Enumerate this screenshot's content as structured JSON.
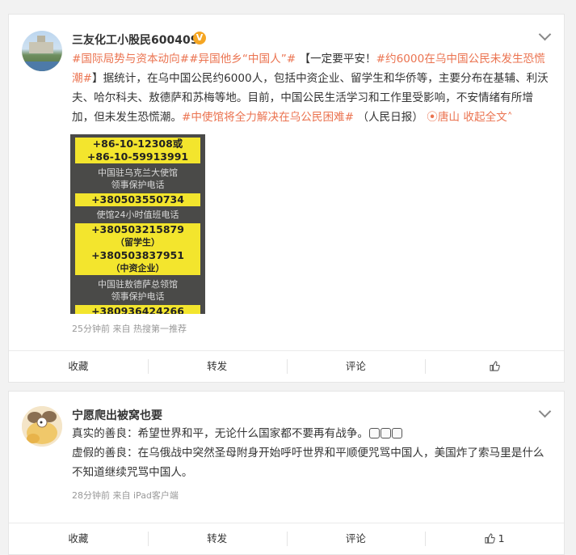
{
  "post1": {
    "username": "三友化工小股民600409",
    "verified_badge": "V",
    "hashtag1": "#国际局势与资本动向#",
    "hashtag2": "#异国他乡“中国人”#",
    "text1": "【一定要平安！",
    "hashtag3": "#约6000在乌中国公民未发生恐慌潮#",
    "text2": "】据统计，在乌中国公民约6000人，包括中资企业、留学生和华侨等，主要分布在基辅、利沃夫、哈尔科夫、敖德萨和苏梅等地。目前，中国公民生活学习和工作里受影响，不安情绪有所增加，但未发生恐慌潮。",
    "hashtag4": "#中使馆将全力解决在乌公民困难#",
    "text3": "（人民日报）",
    "location": "唐山",
    "collapse": "收起全文",
    "poster": {
      "line1": "+86-10-12308或",
      "line2": "+86-10-59913991",
      "line3": "中国驻乌克兰大使馆",
      "line4": "领事保护电话",
      "line5": "+380503550734",
      "line6": "使馆24小时值班电话",
      "line7": "+380503215879",
      "line8": "（留学生）",
      "line9": "+380503837951",
      "line10": "（中资企业）",
      "line11": "中国驻敖德萨总领馆",
      "line12": "领事保护电话",
      "line13": "+380936424266"
    },
    "time": "25分钟前",
    "source": "来自 热搜第一推荐",
    "actions": {
      "favorite": "收藏",
      "repost": "转发",
      "comment": "评论"
    }
  },
  "post2": {
    "username": "宁愿爬出被窝也要",
    "line1": "真实的善良：希望世界和平，无论什么国家都不要再有战争。",
    "line2": "虚假的善良：在乌俄战中突然圣母附身开始呼吁世界和平顺便咒骂中国人，美国炸了索马里是什么不知道继续咒骂中国人。",
    "time": "28分钟前",
    "source": "来自 iPad客户端",
    "actions": {
      "favorite": "收藏",
      "repost": "转发",
      "comment": "评论",
      "like_count": "1"
    }
  },
  "colors": {
    "link": "#eb7350",
    "badge": "#f5a623",
    "poster_yellow": "#f3e52d"
  }
}
